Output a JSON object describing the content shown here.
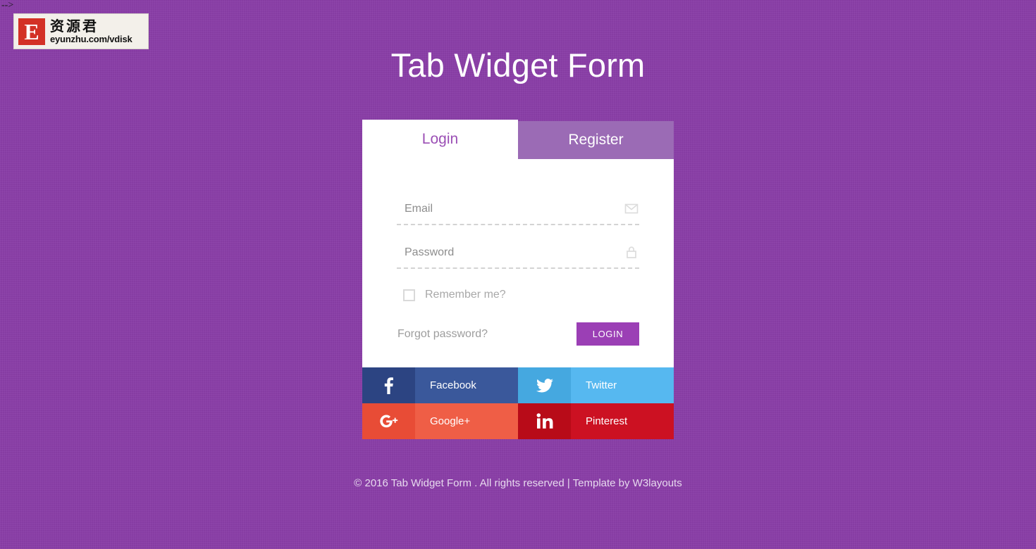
{
  "artifact": {
    "text": "-->"
  },
  "watermark": {
    "logo_letter": "E",
    "chinese": "资源君",
    "url": "eyunzhu.com/vdisk"
  },
  "page": {
    "title": "Tab Widget Form",
    "background_color": "#8a3ea8"
  },
  "tabs": [
    {
      "label": "Login",
      "active": true
    },
    {
      "label": "Register",
      "active": false
    }
  ],
  "form": {
    "email": {
      "placeholder": "Email",
      "value": "",
      "icon": "envelope-icon"
    },
    "password": {
      "placeholder": "Password",
      "value": "",
      "icon": "lock-icon"
    },
    "remember": {
      "label": "Remember me?",
      "checked": false
    },
    "forgot_label": "Forgot password?",
    "submit_label": "LOGIN",
    "submit_color": "#9b3fb5"
  },
  "social": [
    {
      "name": "Facebook",
      "icon": "facebook-icon",
      "icon_bg": "#2c4482",
      "label_bg": "#3a589b"
    },
    {
      "name": "Twitter",
      "icon": "twitter-icon",
      "icon_bg": "#45a8e0",
      "label_bg": "#56b8f0"
    },
    {
      "name": "Google+",
      "icon": "google-plus-icon",
      "icon_bg": "#e84c36",
      "label_bg": "#ef5e46"
    },
    {
      "name": "Pinterest",
      "icon": "linkedin-icon",
      "icon_bg": "#b80b18",
      "label_bg": "#cc1122"
    }
  ],
  "footer": {
    "text": "© 2016 Tab Widget Form . All rights reserved | Template by W3layouts"
  }
}
